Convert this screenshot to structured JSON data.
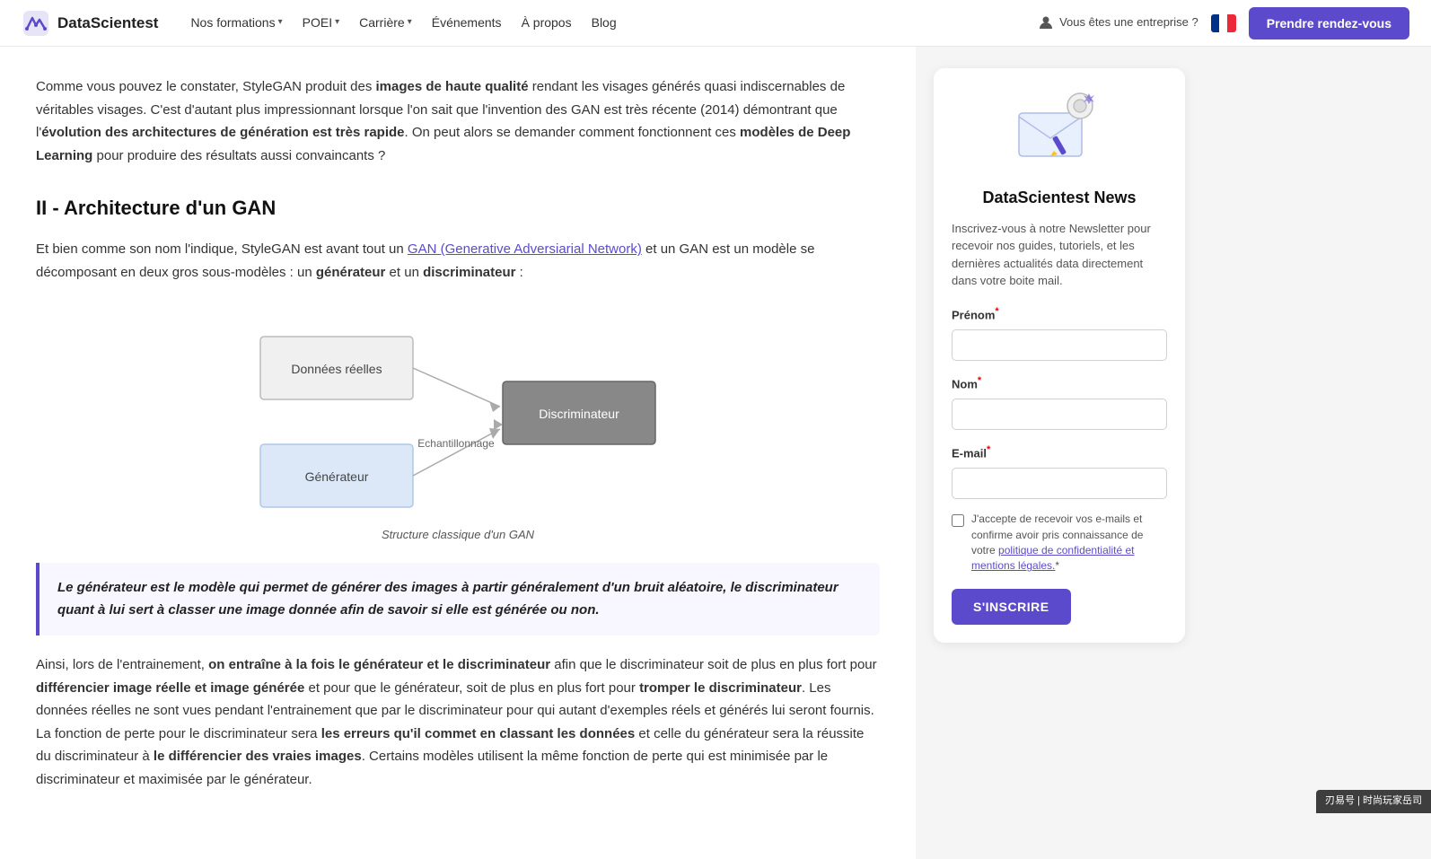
{
  "navbar": {
    "logo_text": "DataScientest",
    "nav_items": [
      {
        "label": "Nos formations",
        "has_chevron": true
      },
      {
        "label": "POEI",
        "has_chevron": true
      },
      {
        "label": "Carrière",
        "has_chevron": true
      },
      {
        "label": "Événements",
        "has_chevron": false
      },
      {
        "label": "À propos",
        "has_chevron": false
      },
      {
        "label": "Blog",
        "has_chevron": false
      }
    ],
    "enterprise_label": "Vous êtes une entreprise ?",
    "cta_label": "Prendre rendez-vous"
  },
  "article": {
    "para1": "Comme vous pouvez le constater, StyleGAN produit des images de haute qualité rendant les visages générés quasi indiscernables de véritables visages. C'est d'autant plus impressionnant lorsque l'on sait que l'invention des GAN est très récente (2014) démontrant que l'évolution des architectures de génération est très rapide. On peut alors se demander comment fonctionnent ces modèles de Deep Learning pour produire des résultats aussi convaincants ?",
    "h2": "II - Architecture d'un GAN",
    "para2_pre": "Et bien comme son nom l'indique, StyleGAN est avant tout un ",
    "para2_link": "GAN (Generative Adversiarial Network)",
    "para2_post": " et un GAN est un modèle se décomposant en deux gros sous-modèles : un générateur et un discriminateur :",
    "diagram_caption": "Structure classique d'un GAN",
    "diagram_labels": {
      "real_data": "Données réelles",
      "generator": "Générateur",
      "discriminator": "Discriminateur",
      "sampling": "Echantillonnage"
    },
    "blockquote": "Le générateur est le modèle qui permet de générer des images à partir généralement d'un bruit aléatoire, le discriminateur quant à lui sert à classer une image donnée afin de savoir si elle est générée ou non.",
    "para3": "Ainsi, lors de l'entrainement, on entraîne à la fois le générateur et le discriminateur afin que le discriminateur soit de plus en plus fort pour différencier image réelle et image générée et pour que le générateur, soit de plus en plus fort pour tromper le discriminateur. Les données réelles ne sont vues pendant l'entrainement que par le discriminateur pour qui autant d'exemples réels et générés lui seront fournis. La fonction de perte pour le discriminateur sera les erreurs qu'il commet en classant les données et celle du générateur sera la réussite du discriminateur à le différencier des vraies images. Certains modèles utilisent la même fonction de perte qui est minimisée par le discriminateur et maximisée par le générateur."
  },
  "sidebar": {
    "newsletter": {
      "title": "DataScientest News",
      "description": "Inscrivez-vous à notre Newsletter pour recevoir nos guides, tutoriels, et les dernières actualités data directement dans votre boite mail.",
      "prenom_label": "Prénom",
      "nom_label": "Nom",
      "email_label": "E-mail",
      "checkbox_label": "J'accepte de recevoir vos e-mails et confirme avoir pris connaissance de votre politique de confidentialité et mentions légales.",
      "submit_label": "S'INSCRIRE"
    }
  },
  "bottom_bar": "刃易号 | 时尚玩家岳司"
}
